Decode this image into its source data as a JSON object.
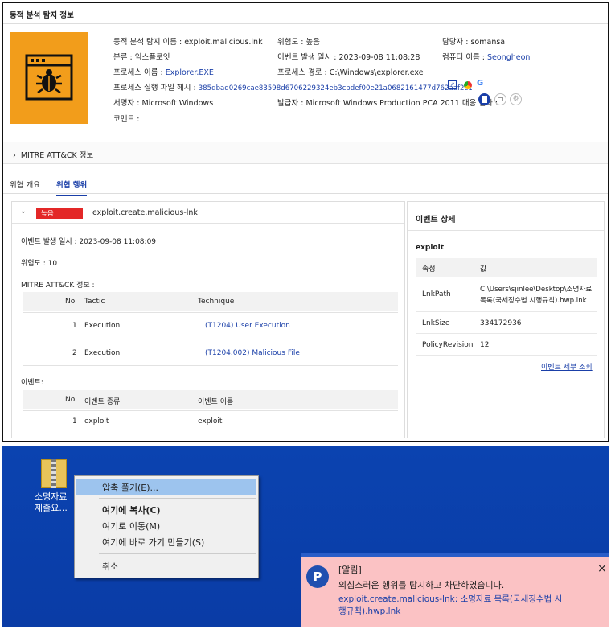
{
  "header": {
    "title": "동적 분석 탐지 정보"
  },
  "info": {
    "name_label": "동적 분석 탐지 이름 :",
    "name_value": "exploit.malicious.lnk",
    "risk_label": "위험도 :",
    "risk_value": "높음",
    "owner_label": "담당자 :",
    "owner_value": "somansa",
    "class_label": "분류 :",
    "class_value": "익스플로잇",
    "time_label": "이벤트 발생 일시 :",
    "time_value": "2023-09-08 11:08:28",
    "computer_label": "컴퓨터 이름 :",
    "computer_value": "Seongheon",
    "proc_label": "프로세스 이름 :",
    "proc_value": "Explorer.EXE",
    "path_label": "프로세스 경로 :",
    "path_value": "C:\\Windows\\explorer.exe",
    "hash_label": "프로세스 실행 파일 해시 :",
    "hash_value": "385dbad0269cae83598d6706229324eb3cbdef00e21a0682161477d762aaf2c1",
    "signer_label": "서명자 :",
    "signer_value": "Microsoft Windows",
    "issuer_label": "발급자 :",
    "issuer_value": "Microsoft Windows Production PCA 2011",
    "response_label": "대응 결과 :",
    "comment_label": "코멘트 :"
  },
  "mitre": {
    "label": "MITRE ATT&CK 정보"
  },
  "tabs": [
    "위협 개요",
    "위협 행위"
  ],
  "event": {
    "badge": "높음",
    "name": "exploit.create.malicious-lnk",
    "time_line": "이벤트 발생 일시 : 2023-09-08 11:08:09",
    "risk_line": "위험도 : 10",
    "mitre_heading": "MITRE ATT&CK 정보 :",
    "mitre_cols": [
      "No.",
      "Tactic",
      "Technique"
    ],
    "mitre_rows": [
      {
        "no": "1",
        "tactic": "Execution",
        "technique": "(T1204) User Execution"
      },
      {
        "no": "2",
        "tactic": "Execution",
        "technique": "(T1204.002) Malicious File"
      }
    ],
    "events_heading": "이벤트:",
    "event_cols": [
      "No.",
      "이벤트 종류",
      "이벤트 이름"
    ],
    "event_rows": [
      {
        "no": "1",
        "kind": "exploit",
        "name": "exploit"
      }
    ]
  },
  "detail": {
    "title": "이벤트 상세",
    "subtitle": "exploit",
    "col_attr": "속성",
    "col_value": "값",
    "rows": [
      {
        "key": "LnkPath",
        "value1": "C:\\Users\\sjinlee\\Desktop\\소명자료",
        "value2": "목록(국세징수법 시행규칙).hwp.lnk"
      },
      {
        "key": "LnkSize",
        "value1": "334172936",
        "value2": ""
      },
      {
        "key": "PolicyRevision",
        "value1": "12",
        "value2": ""
      }
    ],
    "more_link": "이벤트 세부 조회"
  },
  "desktop": {
    "icon_label_1": "소명자료",
    "icon_label_2": "제출요...",
    "menu": [
      "압축 풀기(E)...",
      "여기에 복사(C)",
      "여기로 이동(M)",
      "여기에 바로 가기 만들기(S)",
      "취소"
    ],
    "toast": {
      "title": "[알림]",
      "message": "의심스러운 행위를 탐지하고 차단하였습니다.",
      "detail1": "exploit.create.malicious-lnk: 소명자료 목록(국세징수법 시",
      "detail2": "행규칙).hwp.lnk",
      "close": "×",
      "logo": "P"
    }
  }
}
